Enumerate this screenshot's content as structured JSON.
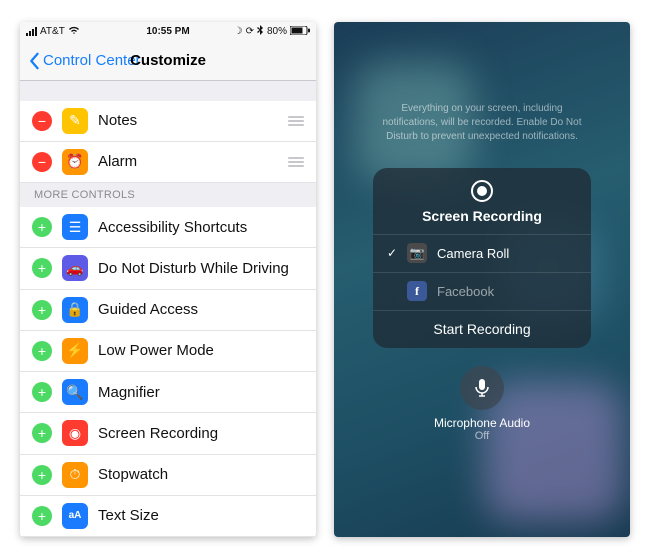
{
  "left": {
    "statusbar": {
      "carrier": "AT&T",
      "time": "10:55 PM",
      "battery": "80%"
    },
    "nav": {
      "back": "Control Center",
      "title": "Customize"
    },
    "included": [
      {
        "label": "Notes",
        "icon_bg": "#ffc400",
        "glyph": "✎",
        "action": "remove"
      },
      {
        "label": "Alarm",
        "icon_bg": "#ff9500",
        "glyph": "⏰",
        "action": "remove"
      }
    ],
    "more_header": "MORE CONTROLS",
    "more": [
      {
        "label": "Accessibility Shortcuts",
        "icon_bg": "#1a7bff",
        "glyph": "☰"
      },
      {
        "label": "Do Not Disturb While Driving",
        "icon_bg": "#5e5ce6",
        "glyph": "🚗"
      },
      {
        "label": "Guided Access",
        "icon_bg": "#1a7bff",
        "glyph": "🔒"
      },
      {
        "label": "Low Power Mode",
        "icon_bg": "#ff9500",
        "glyph": "⚡"
      },
      {
        "label": "Magnifier",
        "icon_bg": "#1a7bff",
        "glyph": "🔍"
      },
      {
        "label": "Screen Recording",
        "icon_bg": "#ff3b30",
        "glyph": "◉"
      },
      {
        "label": "Stopwatch",
        "icon_bg": "#ff9500",
        "glyph": "⏱"
      },
      {
        "label": "Text Size",
        "icon_bg": "#1a7bff",
        "glyph": "aA"
      }
    ]
  },
  "right": {
    "disclaimer": "Everything on your screen, including notifications, will be recorded. Enable Do Not Disturb to prevent unexpected notifications.",
    "sheet_title": "Screen Recording",
    "options": [
      {
        "label": "Camera Roll",
        "selected": true,
        "icon": "camera"
      },
      {
        "label": "Facebook",
        "selected": false,
        "icon": "facebook"
      }
    ],
    "start": "Start Recording",
    "mic": {
      "label": "Microphone Audio",
      "state": "Off"
    }
  }
}
